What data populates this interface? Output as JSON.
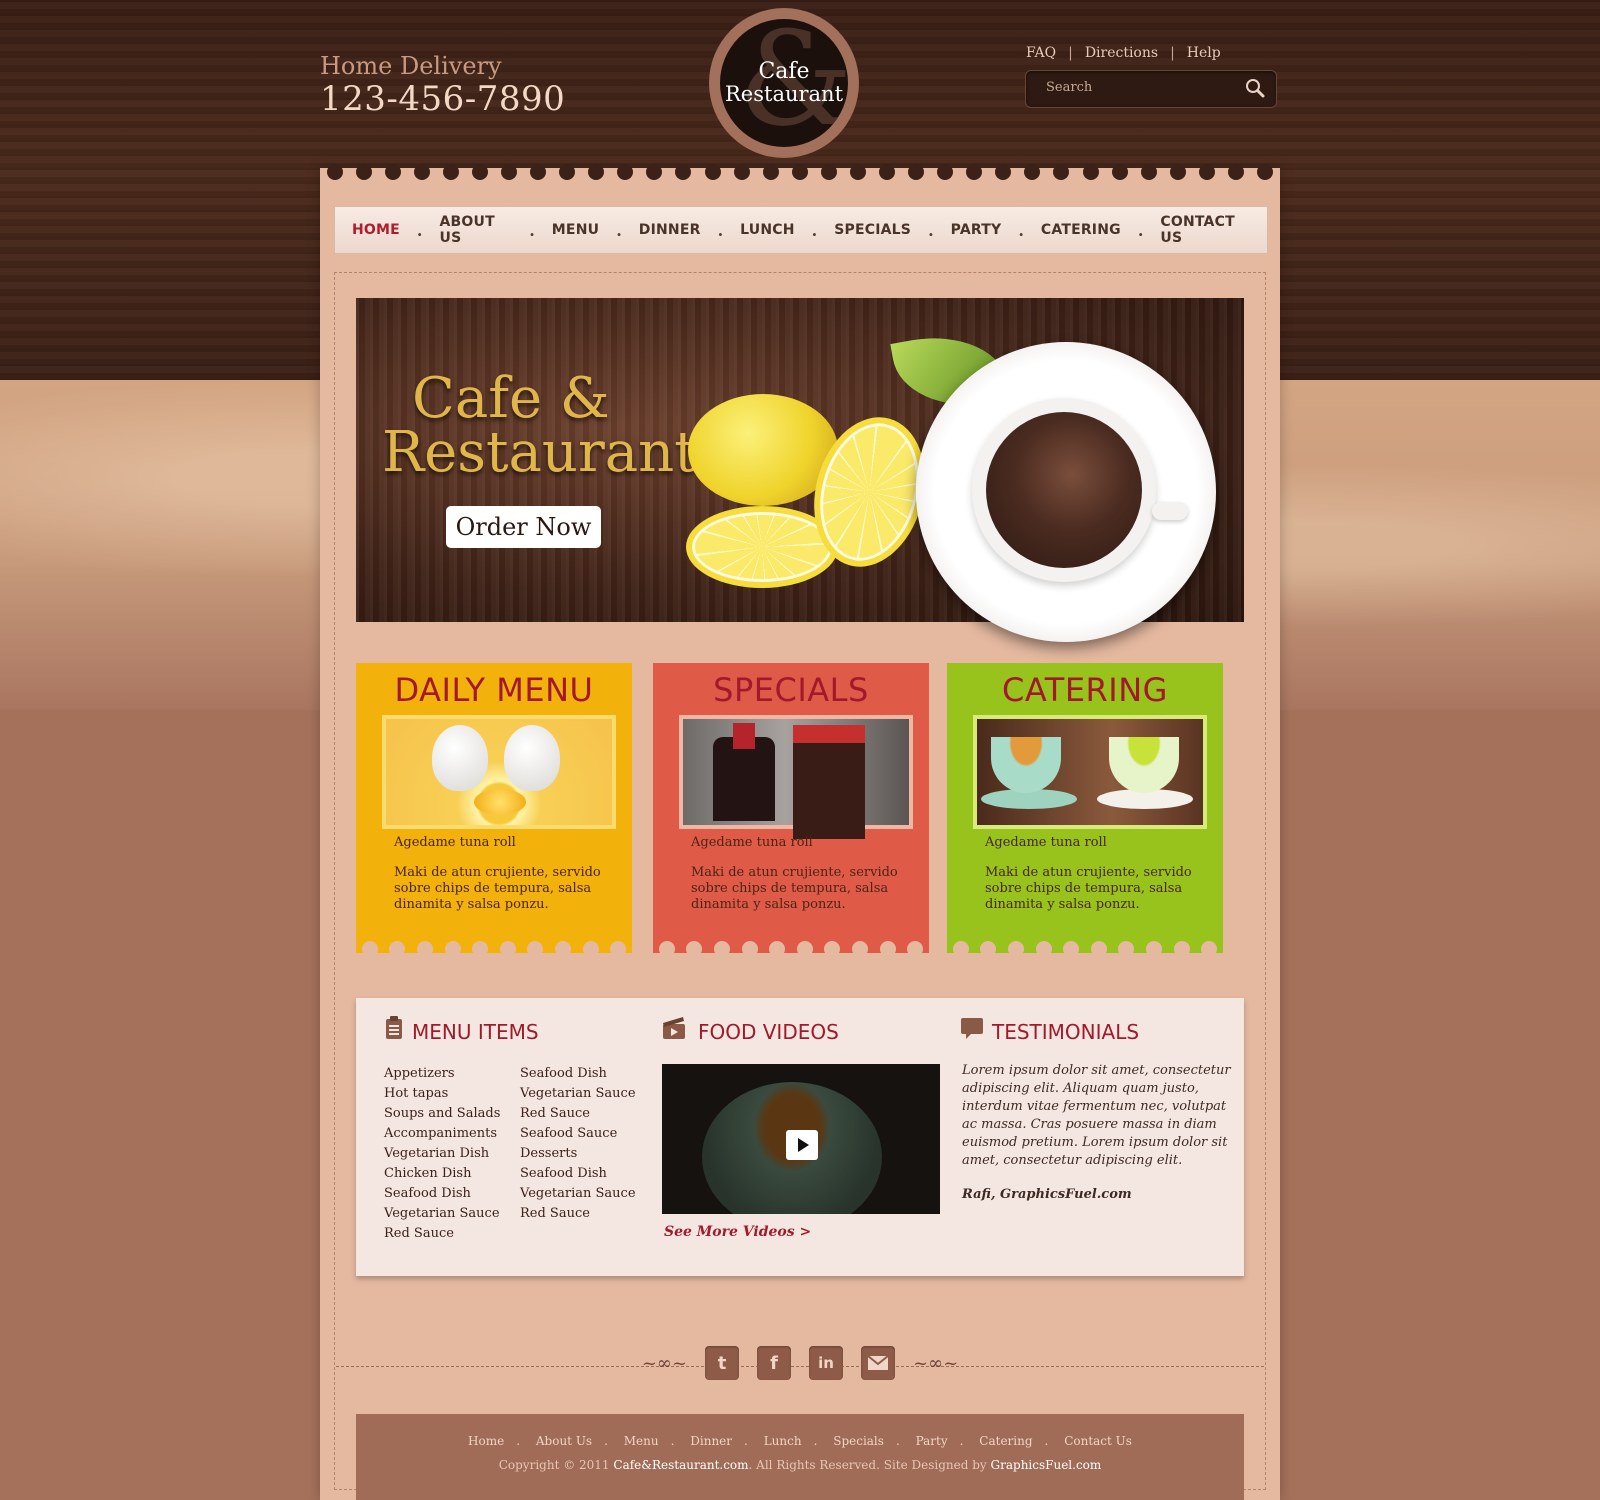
{
  "header": {
    "delivery_label": "Home Delivery",
    "phone": "123-456-7890",
    "logo_line1": "Cafe",
    "logo_line2": "Restaurant",
    "logo_amp": "&",
    "top_links": [
      "FAQ",
      "Directions",
      "Help"
    ],
    "search_placeholder": "Search"
  },
  "nav": {
    "items": [
      "HOME",
      "ABOUT US",
      "MENU",
      "DINNER",
      "LUNCH",
      "SPECIALS",
      "PARTY",
      "CATERING",
      "CONTACT US"
    ],
    "active": "HOME"
  },
  "hero": {
    "title_line1": "Cafe &",
    "title_line2": "Restaurant",
    "button": "Order Now"
  },
  "cards": [
    {
      "title": "DAILY MENU",
      "item_name": "Agedame tuna roll",
      "description": "Maki de atun crujiente, servido sobre chips de tempura, salsa dinamita y salsa ponzu.",
      "color": "#f2b10b"
    },
    {
      "title": "SPECIALS",
      "item_name": "Agedame tuna roll",
      "description": "Maki de atun crujiente, servido sobre chips de tempura, salsa dinamita y salsa ponzu.",
      "color": "#e05a48"
    },
    {
      "title": "CATERING",
      "item_name": "Agedame tuna roll",
      "description": "Maki de atun crujiente, servido sobre chips de tempura, salsa dinamita y salsa ponzu.",
      "color": "#97c31c"
    }
  ],
  "menu_items": {
    "title": "MENU ITEMS",
    "col1": [
      "Appetizers",
      "Hot tapas",
      "Soups and Salads",
      "Accompaniments",
      "Vegetarian Dish",
      "Chicken Dish",
      "Seafood Dish",
      "Vegetarian Sauce",
      "Red Sauce"
    ],
    "col2": [
      "Seafood Dish",
      "Vegetarian Sauce",
      "Red Sauce",
      "Seafood Sauce",
      "Desserts",
      "Seafood Dish",
      "Vegetarian Sauce",
      "Red Sauce"
    ]
  },
  "videos": {
    "title": "FOOD VIDEOS",
    "see_more": "See More Videos >"
  },
  "testimonials": {
    "title": "TESTIMONIALS",
    "quote": "Lorem ipsum dolor sit amet, consectetur adipiscing elit. Aliquam quam justo, interdum vitae fermentum nec, volutpat ac massa. Cras posuere massa in diam euismod pretium. Lorem ipsum dolor sit amet, consectetur adipiscing elit.",
    "author": "Rafi, GraphicsFuel.com"
  },
  "social": [
    "twitter-icon",
    "facebook-icon",
    "linkedin-icon",
    "email-icon"
  ],
  "footer": {
    "links": [
      "Home",
      "About Us",
      "Menu",
      "Dinner",
      "Lunch",
      "Specials",
      "Party",
      "Catering",
      "Contact Us"
    ],
    "copyright_prefix": "Copyright © 2011",
    "site": "Cafe&Restaurant.com",
    "rights": ". All Rights Reserved. Site Designed by",
    "designer": "GraphicsFuel.com"
  },
  "colors": {
    "accent_red": "#a2192a",
    "wood_dark": "#3a1f15",
    "paper": "#e5b9a0"
  }
}
